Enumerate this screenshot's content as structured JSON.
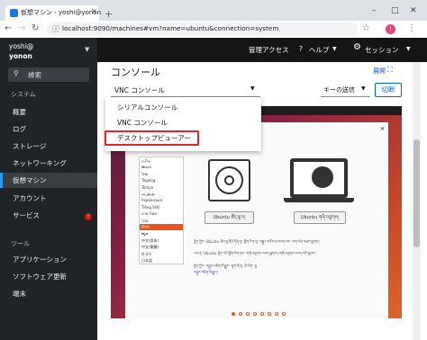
{
  "browser": {
    "tab_title": "仮想マシン - yoshi@yonon",
    "new_tab": "+",
    "minimize": "–",
    "maximize": "□",
    "close": "✕",
    "url": "localhost:9090/machines#vm?name=ubuntu&connection=system",
    "profile_initial": "I"
  },
  "sidebar": {
    "user": "yoshi@",
    "host": "yonon",
    "search_label": "検索",
    "system_header": "システム",
    "items": [
      "概要",
      "ログ",
      "ストレージ",
      "ネットワーキング",
      "仮想マシン",
      "アカウント",
      "サービス"
    ],
    "services_badge": "!",
    "tools_header": "ツール",
    "tools": [
      "アプリケーション",
      "ソフトウェア更新",
      "端末"
    ]
  },
  "topnav": {
    "admin_access": "管理アクセス",
    "help": "ヘルプ",
    "session": "セッション"
  },
  "console": {
    "title": "コンソール",
    "expand": "展開",
    "type_selected": "VNC コンソール",
    "key_send": "キーの送信",
    "disconnect": "切断",
    "menu_options": [
      "シリアルコンソール",
      "VNC コンソール",
      "デスクトップビューアー"
    ],
    "highlighted_option": "デスクトップビューアー"
  },
  "vm_screen": {
    "languages": [
      "தமிழ்",
      "తెలుగు",
      "ไทย",
      "Tagalog",
      "Türkçe",
      "ئۇيغۇرچە",
      "Українська",
      "Tiếng Việt",
      "ภาษาไทย",
      "ʻaia",
      "ཇོང་ཁ",
      "ಕನ್ನಡ",
      "中文(简体)",
      "中文(繁體)",
      "한국어",
      "日本語"
    ],
    "selected_language": "ཇོང་ཁ",
    "try_button": "Ubuntu ཚོད་ལྟ་བ།",
    "install_button": "Ubuntu གཞི་བཙུགས།",
    "para1": "ཁྱེད་ཀྱིས་ Ubuntu ཚོད་ལྟ་ནིའི་དོན་ལུ་ གློག་རིག་ལུ་ བསྒྱུར་བཅོས་མ་འབད་བར་ ལག་ལེན་འཐབ་ཚུགས།",
    "para2": "ཡང་ན་ Ubuntu ཁྱེད་རའི་གློག་རིག་ནང་ གཞི་བཙུགས་འབད་ཚུགས། གཞི་བཙུགས་འབད་བའི་སྐབས་",
    "para3": "ཁྱེད་ཀྱིས་ བསྐྱར་འཛིན་ལོ་རྒྱུས་ ལྷག་ནི་ལུ་ ཐོ་ཡིག་ ལྷག་",
    "link": "བསྐྱར་འཛིན་ལོ་རྒྱུས།",
    "page_dots": 8,
    "active_dot": 1
  }
}
